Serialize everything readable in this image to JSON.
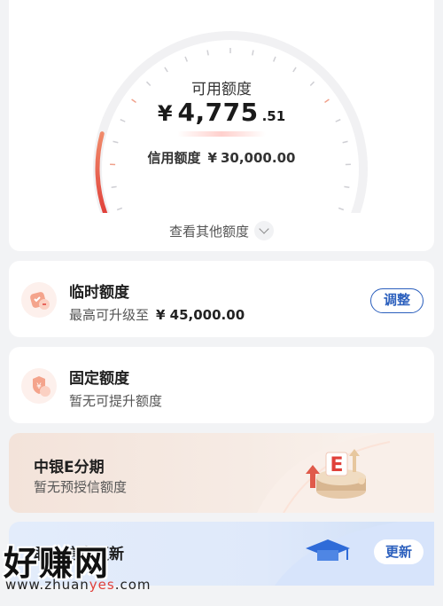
{
  "available": {
    "label": "可用额度",
    "currency": "¥",
    "integer": "4,775",
    "decimal": ".51",
    "gauge_fraction": 0.16
  },
  "credit_limit": {
    "label": "信用额度",
    "currency": "¥",
    "value": "30,000.00"
  },
  "view_other": {
    "label": "查看其他额度",
    "icon": "chevron-down-icon"
  },
  "temp_limit": {
    "title": "临时额度",
    "sub_label": "最高可升级至",
    "sub_value": "¥ 45,000.00",
    "button": "调整",
    "icon": "temp-limit-icon"
  },
  "fixed_limit": {
    "title": "固定额度",
    "sub": "暂无可提升额度",
    "icon": "shield-icon"
  },
  "e_installment": {
    "title": "中银E分期",
    "sub": "暂无预授信额度",
    "icon": "e-installment-illustration"
  },
  "info_update": {
    "title": "职业信息更新",
    "button": "更新",
    "icon": "graduation-cap-icon"
  },
  "watermark": {
    "big": "好赚网",
    "url_part1": "www.zhuan",
    "url_part2": "yes",
    "url_part3": ".com"
  },
  "colors": {
    "accent_blue": "#2b5fbd",
    "gauge_red": "#e0403a",
    "page_bg": "#f2f3f5"
  }
}
